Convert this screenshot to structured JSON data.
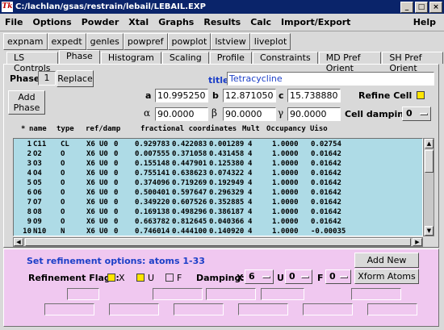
{
  "window": {
    "title": "C:/lachlan/gsas/restrain/lebail/LEBAIL.EXP",
    "app_icon": "Tk"
  },
  "menubar": {
    "items": [
      "File",
      "Options",
      "Powder",
      "Xtal",
      "Graphs",
      "Results",
      "Calc",
      "Import/Export"
    ],
    "help": "Help"
  },
  "toolbar": {
    "buttons": [
      "expnam",
      "expedt",
      "genles",
      "powpref",
      "powplot",
      "lstview",
      "liveplot"
    ]
  },
  "tabs": {
    "items": [
      "LS Controls",
      "Phase",
      "Histogram",
      "Scaling",
      "Profile",
      "Constraints",
      "MD Pref Orient",
      "SH Pref Orient"
    ],
    "active": "Phase"
  },
  "phase": {
    "label": "Phase:",
    "number": "1",
    "replace_label": "Replace",
    "add_label_1": "Add",
    "add_label_2": "Phase",
    "title_label": "title:",
    "title_value": "Tetracycline",
    "cell": {
      "a_label": "a",
      "a": "10.995250",
      "b_label": "b",
      "b": "12.871050",
      "c_label": "c",
      "c": "15.738880",
      "alpha_label": "α",
      "alpha": "90.0000",
      "beta_label": "β",
      "beta": "90.0000",
      "gamma_label": "γ",
      "gamma": "90.0000"
    },
    "refine_cell_label": "Refine Cell",
    "cell_damping_label": "Cell damping",
    "cell_damping_value": "0",
    "title_color": "#1c3fc8",
    "check_color": "#ffe500"
  },
  "atoms": {
    "headers": [
      "*",
      "name",
      "type",
      "ref/damp",
      "fractional coordinates",
      "Mult",
      "Occupancy",
      "Uiso"
    ],
    "rows": [
      [
        "1",
        "C11",
        "CL",
        "X6",
        "U0",
        "0",
        "0.929783",
        "0.422083",
        "0.001289",
        "4",
        "1.0000",
        "0.02754"
      ],
      [
        "2",
        "O2",
        "O",
        "X6",
        "U0",
        "0",
        "0.007555",
        "0.371058",
        "0.431458",
        "4",
        "1.0000",
        "0.01642"
      ],
      [
        "3",
        "O3",
        "O",
        "X6",
        "U0",
        "0",
        "0.155148",
        "0.447901",
        "0.125380",
        "4",
        "1.0000",
        "0.01642"
      ],
      [
        "4",
        "O4",
        "O",
        "X6",
        "U0",
        "0",
        "0.755141",
        "0.638623",
        "0.074322",
        "4",
        "1.0000",
        "0.01642"
      ],
      [
        "5",
        "O5",
        "O",
        "X6",
        "U0",
        "0",
        "0.374096",
        "0.719269",
        "0.192949",
        "4",
        "1.0000",
        "0.01642"
      ],
      [
        "6",
        "O6",
        "O",
        "X6",
        "U0",
        "0",
        "0.500401",
        "0.597647",
        "0.296329",
        "4",
        "1.0000",
        "0.01642"
      ],
      [
        "7",
        "O7",
        "O",
        "X6",
        "U0",
        "0",
        "0.349220",
        "0.607526",
        "0.352885",
        "4",
        "1.0000",
        "0.01642"
      ],
      [
        "8",
        "O8",
        "O",
        "X6",
        "U0",
        "0",
        "0.169138",
        "0.498296",
        "0.386187",
        "4",
        "1.0000",
        "0.01642"
      ],
      [
        "9",
        "O9",
        "O",
        "X6",
        "U0",
        "0",
        "0.663782",
        "0.812645",
        "0.040366",
        "4",
        "1.0000",
        "0.01642"
      ],
      [
        "10",
        "N10",
        "N",
        "X6",
        "U0",
        "0",
        "0.746014",
        "0.444100",
        "0.140920",
        "4",
        "1.0000",
        "-0.00035"
      ]
    ],
    "list_bg": "#aedbe6"
  },
  "refinement": {
    "title": "Set refinement options: atoms 1-33",
    "add_new_atoms": "Add New Atoms",
    "xform_atoms": "Xform Atoms",
    "flags_label": "Refinement Flags:",
    "flag_x": "X",
    "flag_u": "U",
    "flag_f": "F",
    "damping_label": "Damping:",
    "damp_x_label": "X",
    "damp_x_value": "6",
    "damp_u_label": "U",
    "damp_u_value": "0",
    "damp_f_label": "F",
    "damp_f_value": "0",
    "bg_color": "#f0c8f0"
  }
}
